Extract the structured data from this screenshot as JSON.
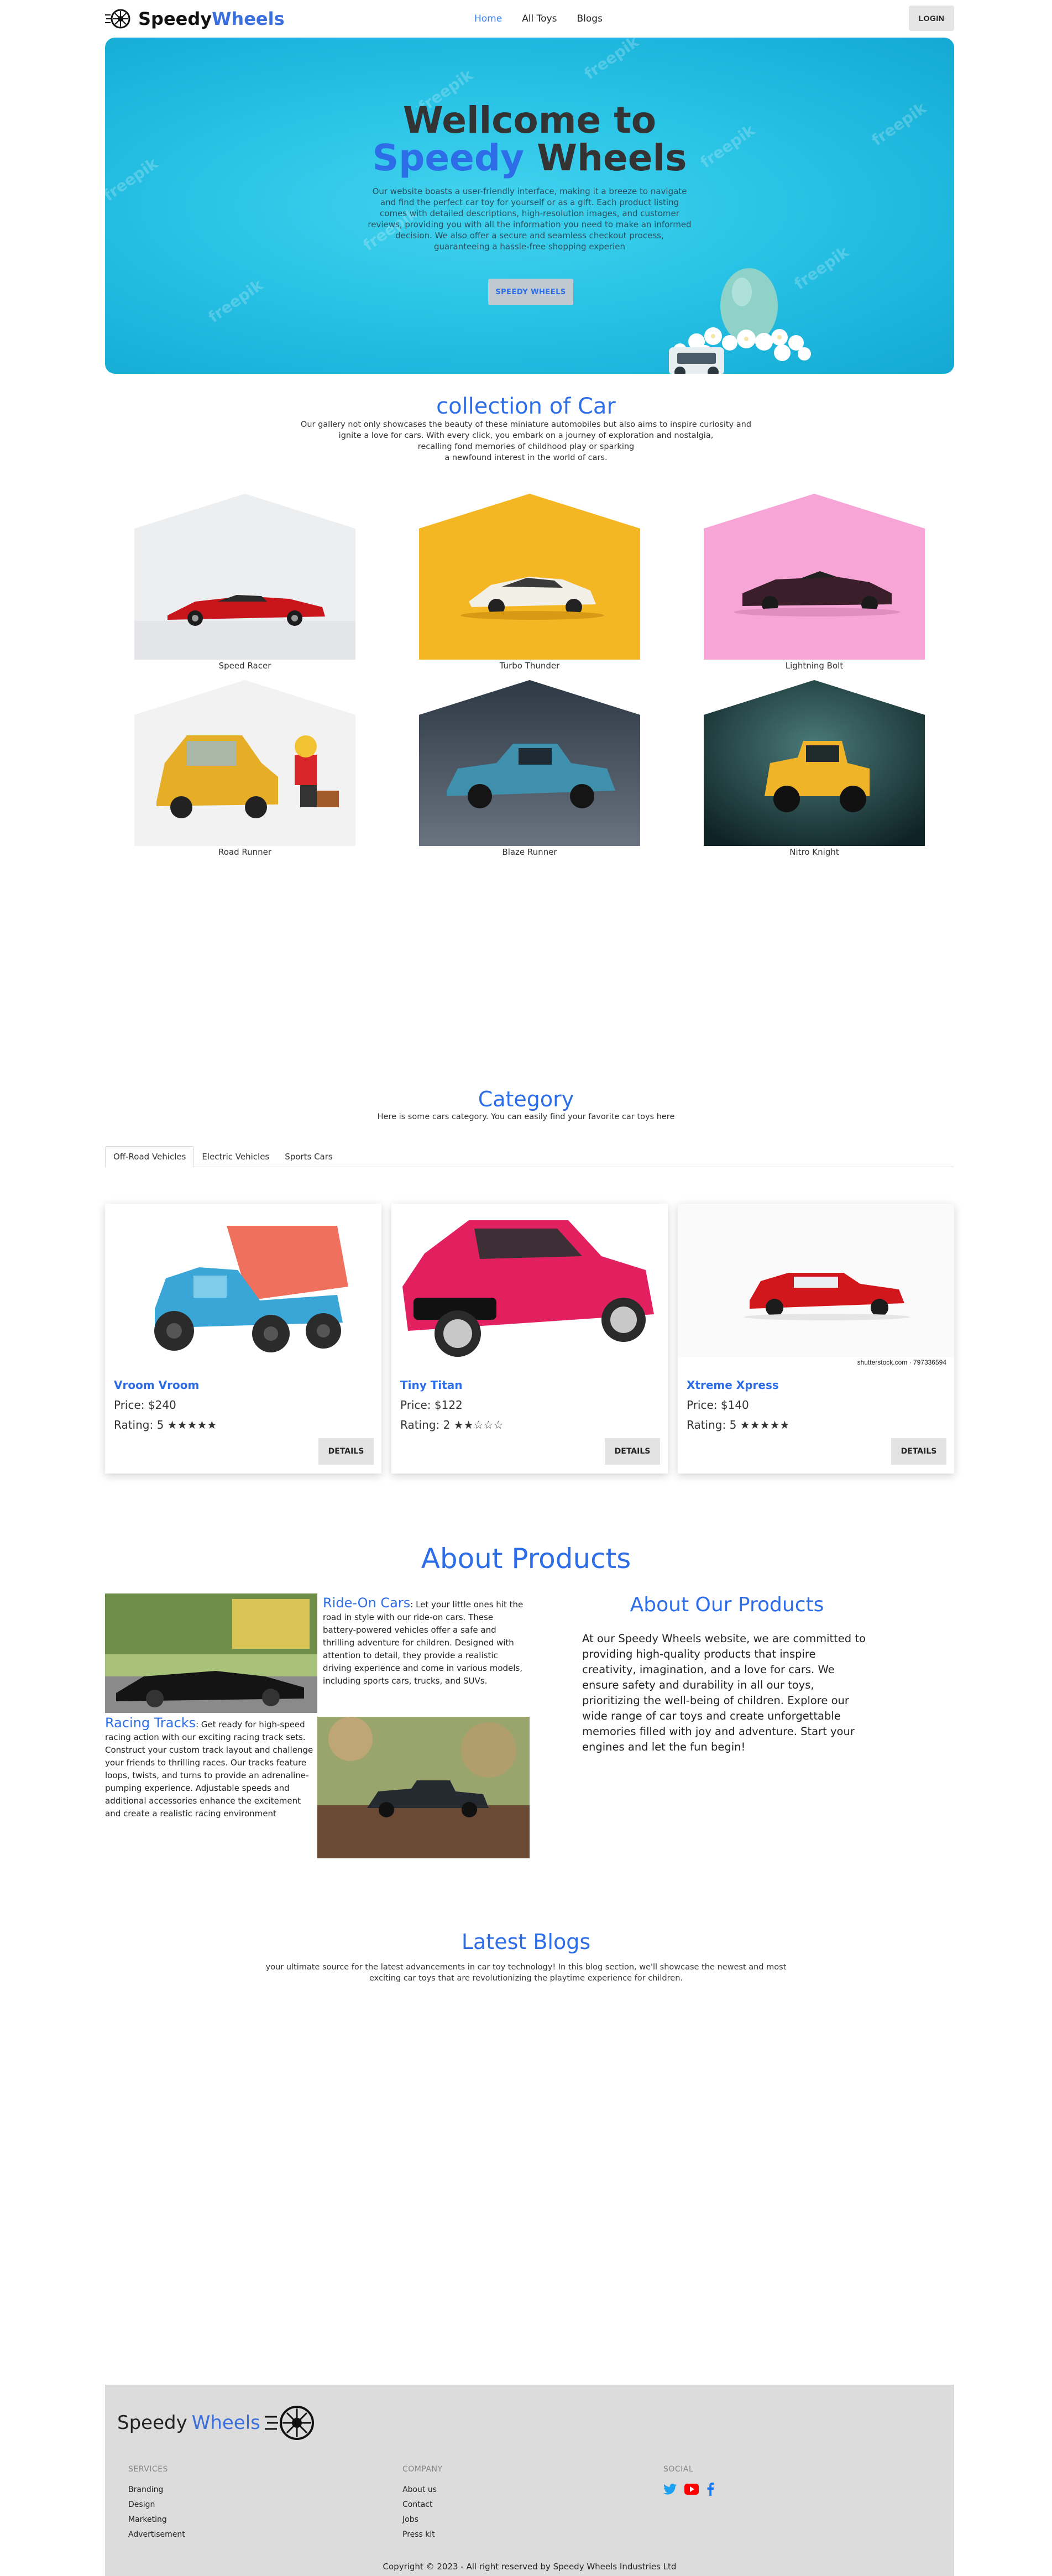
{
  "nav": {
    "brand_first": "Speedy",
    "brand_second": "Wheels",
    "items": [
      {
        "label": "Home",
        "active": true
      },
      {
        "label": "All Toys"
      },
      {
        "label": "Blogs"
      }
    ],
    "login": "LOGIN"
  },
  "hero": {
    "title_line1": "Wellcome to",
    "title_word1": "Speedy",
    "title_word2": "Wheels",
    "description": "Our website boasts a user-friendly interface, making it a breeze to navigate and find the perfect car toy for yourself or as a gift. Each product listing comes with detailed descriptions, high-resolution images, and customer reviews, providing you with all the information you need to make an informed decision. We also offer a secure and seamless checkout process, guaranteeing a hassle-free shopping experien",
    "button": "SPEEDY WHEELS",
    "watermark": "freepik"
  },
  "collection": {
    "title": "collection of Car",
    "description_lines": [
      "Our gallery not only showcases the beauty of these miniature automobiles but also aims to inspire curiosity and",
      "ignite a love for cars. With every click, you embark on a journey of exploration and nostalgia,",
      "recalling fond memories of childhood play or sparking",
      "a newfound interest in the world of cars."
    ],
    "cars": [
      "Speed Racer",
      "Turbo Thunder",
      "Lightning Bolt",
      "Road Runner",
      "Blaze Runner",
      "Nitro Knight"
    ]
  },
  "category": {
    "title": "Category",
    "description": "Here is some cars category. You can easily find your favorite car toys here",
    "tabs": [
      "Off-Road Vehicles",
      "Electric Vehicles",
      "Sports Cars"
    ],
    "products": [
      {
        "name": "Vroom Vroom",
        "price": "Price: $240",
        "rating": "Rating: 5",
        "stars": 5,
        "button": "DETAILS"
      },
      {
        "name": "Tiny Titan",
        "price": "Price: $122",
        "rating": "Rating: 2",
        "stars": 2,
        "button": "DETAILS"
      },
      {
        "name": "Xtreme Xpress",
        "price": "Price: $140",
        "rating": "Rating: 5",
        "stars": 5,
        "button": "DETAILS",
        "credit": "shutterstock.com · 797336594"
      }
    ]
  },
  "about": {
    "title": "About Products",
    "ride_title": "Ride-On Cars",
    "ride_text": ": Let your little ones hit the road in style with our ride-on cars. These battery-powered vehicles offer a safe and thrilling adventure for children. Designed with attention to detail, they provide a realistic driving experience and come in various models, including sports cars, trucks, and SUVs.",
    "track_title": "Racing Tracks",
    "track_text": ": Get ready for high-speed racing action with our exciting racing track sets. Construct your custom track layout and challenge your friends to thrilling races. Our tracks feature loops, twists, and turns to provide an adrenaline-pumping experience. Adjustable speeds and additional accessories enhance the excitement and create a realistic racing environment",
    "right_title": "About Our Products",
    "right_text": "At our Speedy Wheels website, we are committed to providing high-quality products that inspire creativity, imagination, and a love for cars. We ensure safety and durability in all our toys, prioritizing the well-being of children. Explore our wide range of car toys and create unforgettable memories filled with joy and adventure. Start your engines and let the fun begin!"
  },
  "blogs": {
    "title": "Latest Blogs",
    "line1": "your ultimate source for the latest advancements in car toy technology! In this blog section, we'll showcase the newest and most",
    "line2": "exciting car toys that are revolutionizing the playtime experience for children."
  },
  "footer": {
    "brand_first": "Speedy",
    "brand_second": "Wheels",
    "services_title": "SERVICES",
    "services": [
      "Branding",
      "Design",
      "Marketing",
      "Advertisement"
    ],
    "company_title": "COMPANY",
    "company": [
      "About us",
      "Contact",
      "Jobs",
      "Press kit"
    ],
    "social_title": "SOCIAL",
    "copyright": "Copyright © 2023 - All right reserved by Speedy Wheels Industries Ltd"
  },
  "colors": {
    "accent": "#2d6ee8",
    "hero": "#29c3e6",
    "footer": "#dcdcdc"
  }
}
